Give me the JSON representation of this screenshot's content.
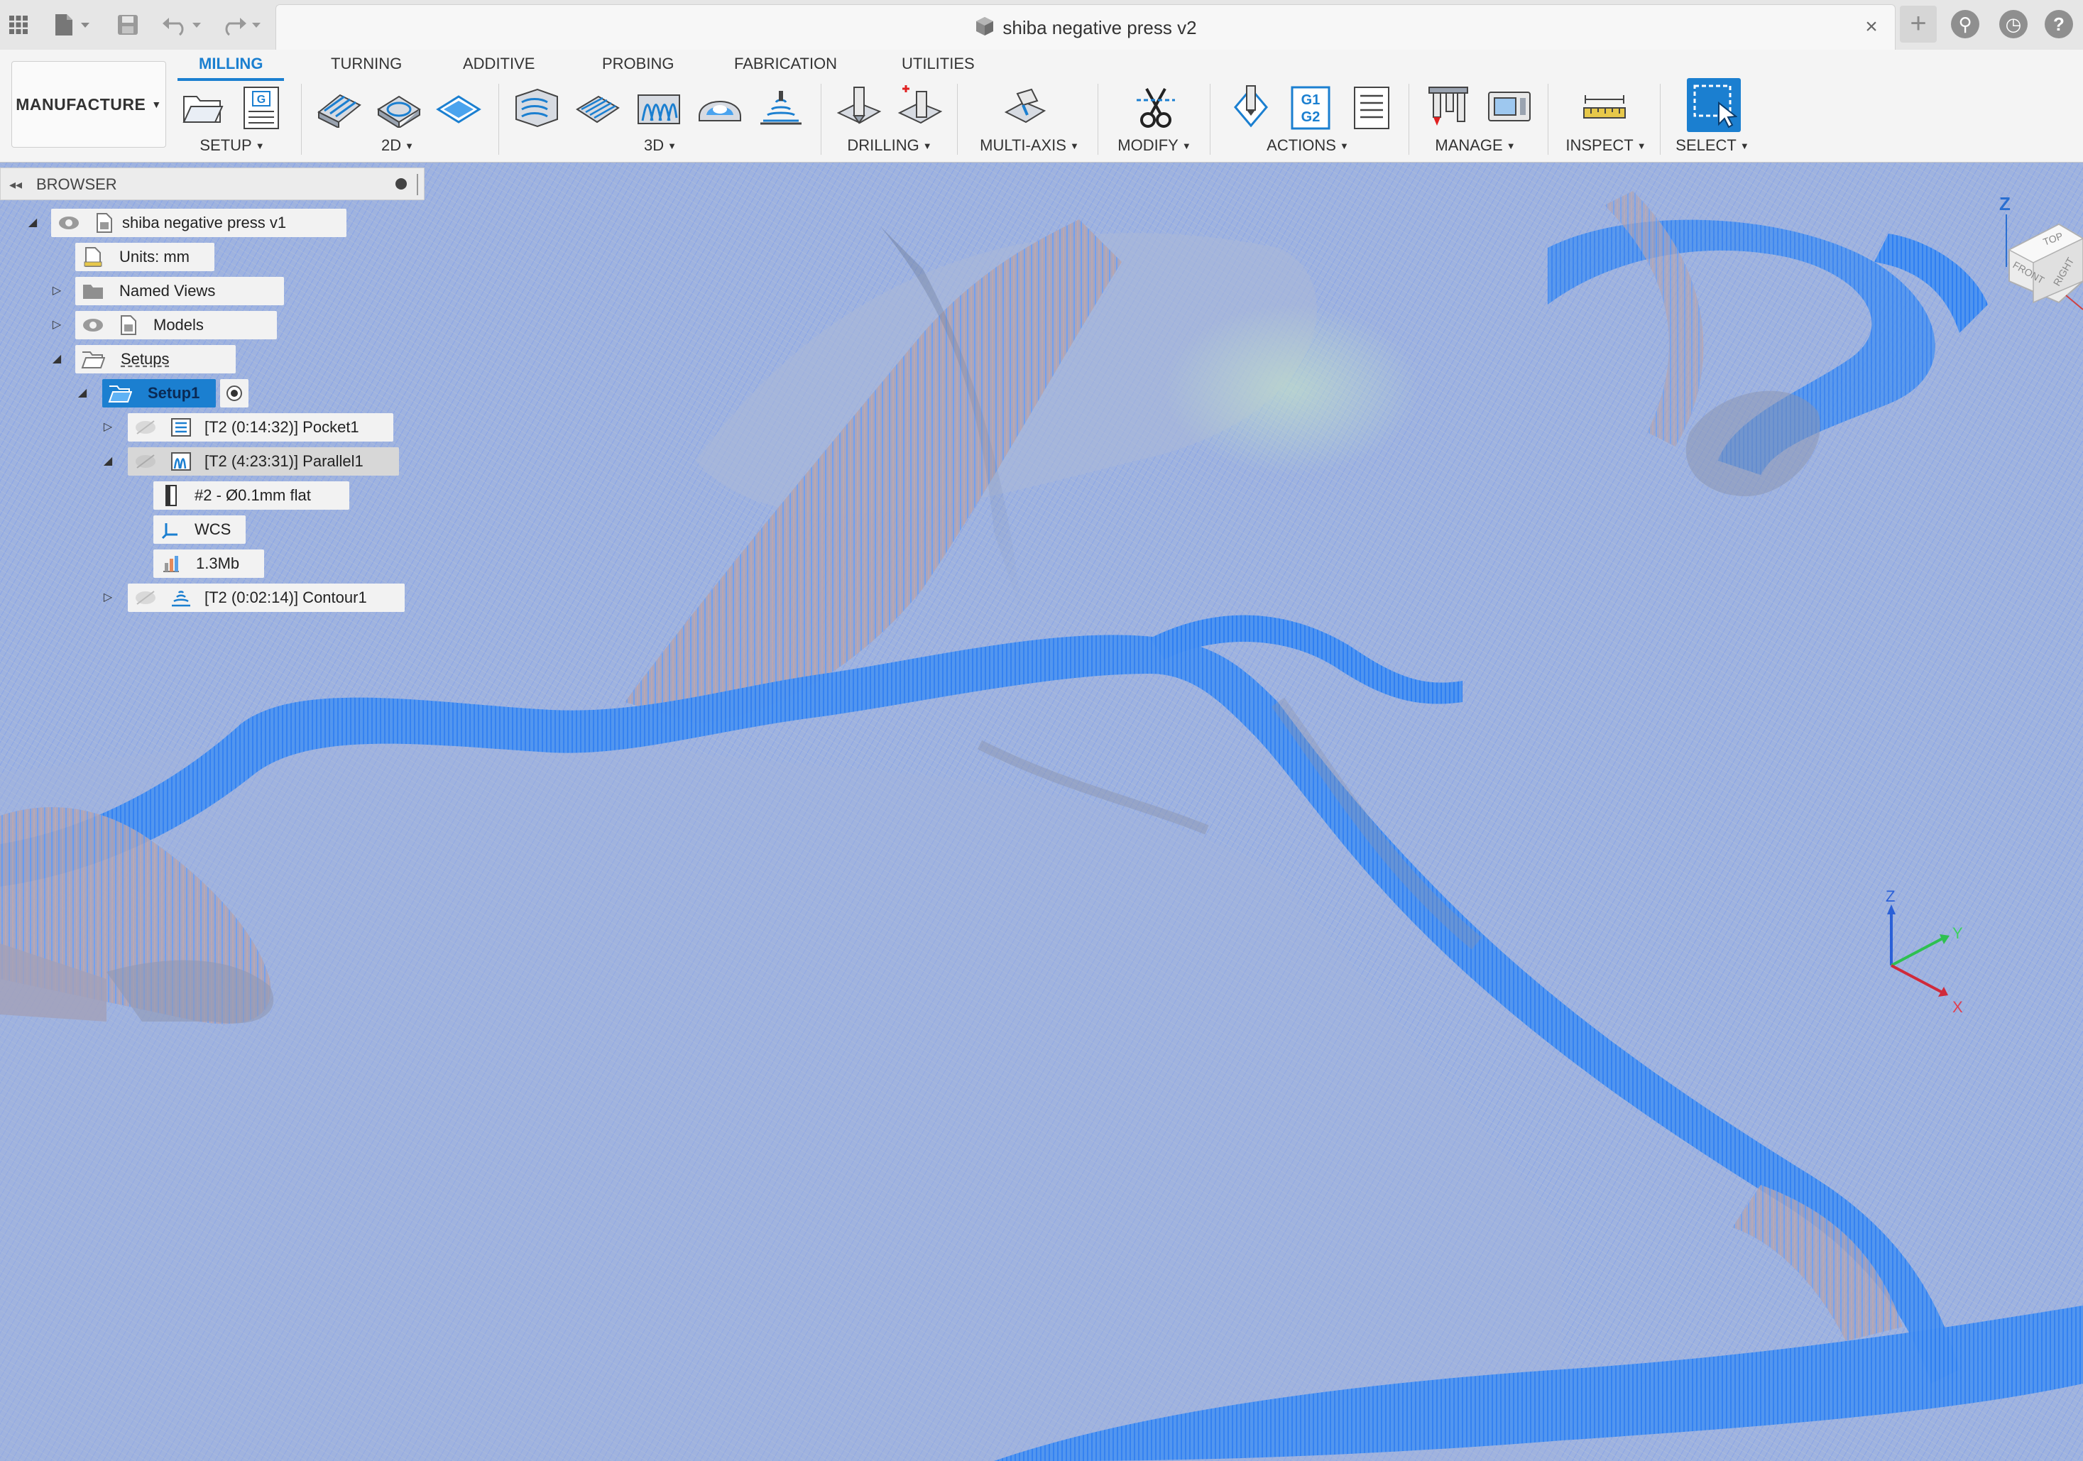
{
  "title_bar": {
    "document_title": "shiba negative press v2",
    "icons": [
      "apps-grid-icon",
      "file-icon",
      "save-icon",
      "undo-icon",
      "redo-icon",
      "close-icon",
      "plus-icon",
      "extensions-icon",
      "job-status-icon",
      "help-icon"
    ]
  },
  "ribbon": {
    "workspace": "MANUFACTURE",
    "tabs": [
      {
        "label": "MILLING",
        "active": true
      },
      {
        "label": "TURNING"
      },
      {
        "label": "ADDITIVE"
      },
      {
        "label": "PROBING"
      },
      {
        "label": "FABRICATION"
      },
      {
        "label": "UTILITIES"
      }
    ],
    "panels": [
      {
        "label": "SETUP"
      },
      {
        "label": "2D"
      },
      {
        "label": "3D"
      },
      {
        "label": "DRILLING"
      },
      {
        "label": "MULTI-AXIS"
      },
      {
        "label": "MODIFY"
      },
      {
        "label": "ACTIONS"
      },
      {
        "label": "MANAGE"
      },
      {
        "label": "INSPECT"
      },
      {
        "label": "SELECT"
      }
    ],
    "post_process_text": "G1 G2"
  },
  "browser": {
    "title": "BROWSER",
    "tree": {
      "root": "shiba negative press v1",
      "units": "Units: mm",
      "named_views": "Named Views",
      "models": "Models",
      "setups": "Setups",
      "setup1": "Setup1",
      "pocket": "[T2 (0:14:32)] Pocket1",
      "parallel": "[T2 (4:23:31)] Parallel1",
      "tool": "#2 - Ø0.1mm flat",
      "wcs": "WCS",
      "size": "1.3Mb",
      "contour": "[T2 (0:02:14)] Contour1"
    }
  },
  "viewcube": {
    "faces": [
      "TOP",
      "FRONT",
      "RIGHT"
    ],
    "axis": "Z"
  },
  "triad": {
    "z": "Z",
    "y": "Y",
    "x": "X"
  },
  "colors": {
    "accent": "#1b7fd0",
    "toolpath": "#3b8ef0",
    "stock": "#9cb0dc"
  }
}
